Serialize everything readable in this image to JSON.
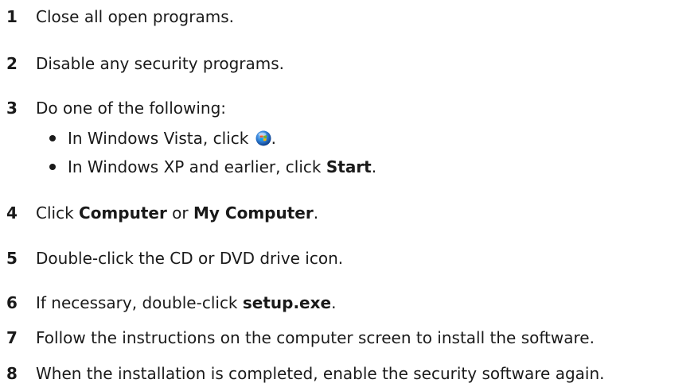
{
  "steps": [
    {
      "num": "1",
      "text": "Close all open programs."
    },
    {
      "num": "2",
      "text": "Disable any security programs."
    },
    {
      "num": "3",
      "text": "Do one of the following:"
    },
    {
      "num": "4",
      "pre": "Click ",
      "bold1": "Computer",
      "mid": " or ",
      "bold2": "My Computer",
      "post": "."
    },
    {
      "num": "5",
      "text": "Double-click the CD or DVD drive icon."
    },
    {
      "num": "6",
      "pre": "If necessary, double-click ",
      "bold": "setup.exe",
      "post": "."
    },
    {
      "num": "7",
      "text": "Follow the instructions on the computer screen to install the software."
    },
    {
      "num": "8",
      "text": "When the installation is completed, enable the security software again."
    }
  ],
  "substeps": [
    {
      "pre": "In Windows Vista, click ",
      "icon": "windows-start-orb-icon",
      "post": "."
    },
    {
      "pre": "In Windows XP and earlier, click ",
      "bold": "Start",
      "post": "."
    }
  ],
  "colors": {
    "text": "#1a1a1a",
    "orb_blue": "#2f7fd6"
  }
}
